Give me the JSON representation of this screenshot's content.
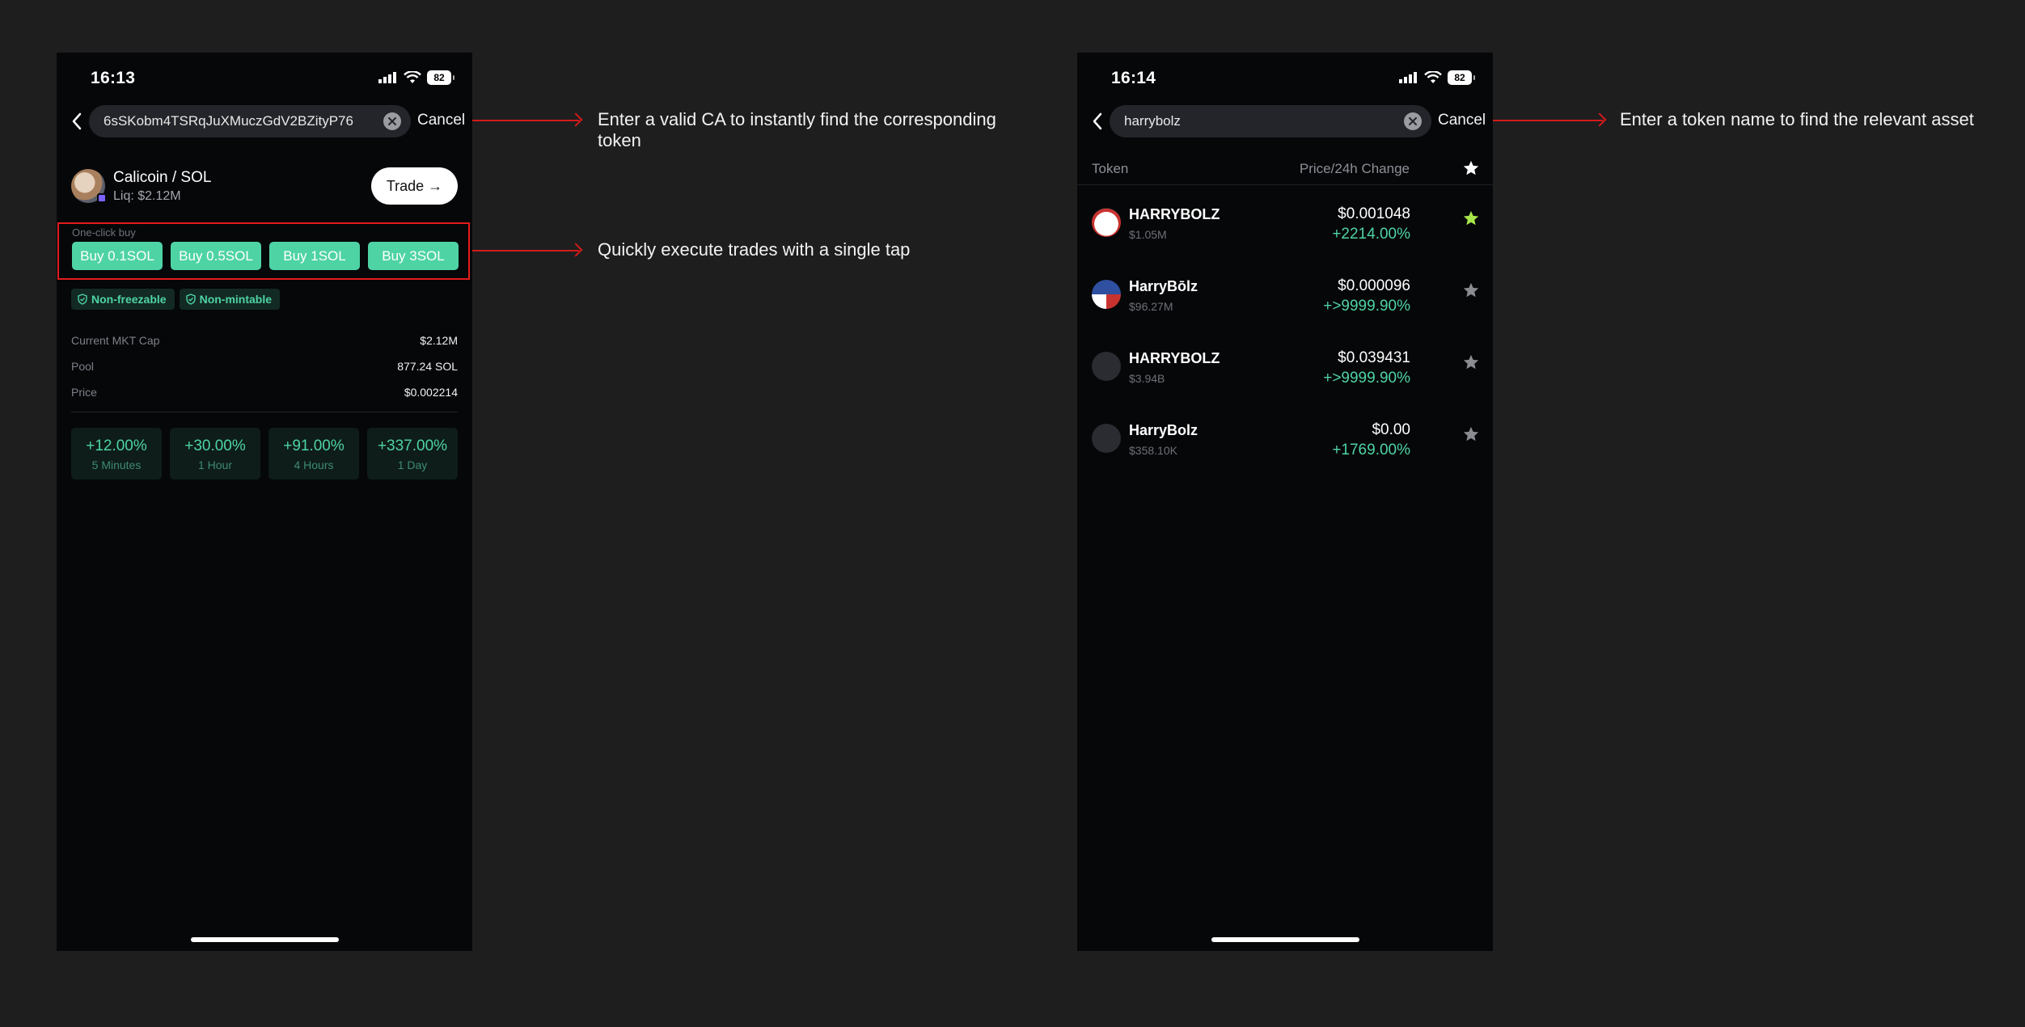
{
  "left_screen": {
    "status": {
      "time": "16:13",
      "battery": "82"
    },
    "search": {
      "value": "6sSKobm4TSRqJuXMuczGdV2BZityP76",
      "cancel_label": "Cancel"
    },
    "token": {
      "title": "Calicoin / SOL",
      "liquidity": "Liq: $2.12M",
      "trade_label": "Trade →"
    },
    "one_click": {
      "label": "One-click buy",
      "buttons": [
        "Buy 0.1SOL",
        "Buy 0.5SOL",
        "Buy 1SOL",
        "Buy 3SOL"
      ]
    },
    "tags": [
      "Non-freezable",
      "Non-mintable"
    ],
    "stats": [
      {
        "label": "Current MKT Cap",
        "value": "$2.12M"
      },
      {
        "label": "Pool",
        "value": "877.24 SOL"
      },
      {
        "label": "Price",
        "value": "$0.002214"
      }
    ],
    "changes": [
      {
        "value": "+12.00%",
        "period": "5 Minutes"
      },
      {
        "value": "+30.00%",
        "period": "1 Hour"
      },
      {
        "value": "+91.00%",
        "period": "4 Hours"
      },
      {
        "value": "+337.00%",
        "period": "1 Day"
      }
    ]
  },
  "right_screen": {
    "status": {
      "time": "16:14",
      "battery": "82"
    },
    "search": {
      "value": "harrybolz",
      "cancel_label": "Cancel"
    },
    "list_header": {
      "token": "Token",
      "price_change": "Price/24h Change"
    },
    "tokens": [
      {
        "name": "HARRYBOLZ",
        "mcap": "$1.05M",
        "price": "$0.001048",
        "change": "+2214.00%",
        "favorited": true
      },
      {
        "name": "HarryBōlz",
        "mcap": "$96.27M",
        "price": "$0.000096",
        "change": "+>9999.90%",
        "favorited": false
      },
      {
        "name": "HARRYBOLZ",
        "mcap": "$3.94B",
        "price": "$0.039431",
        "change": "+>9999.90%",
        "favorited": false
      },
      {
        "name": "HarryBolz",
        "mcap": "$358.10K",
        "price": "$0.00",
        "change": "+1769.00%",
        "favorited": false
      }
    ]
  },
  "annotations": {
    "search_ca": "Enter a valid CA to instantly find the corresponding token",
    "one_click": "Quickly execute trades with a single tap",
    "search_name": "Enter a token name to find the relevant asset"
  },
  "colors": {
    "background": "#1e1e1f",
    "phone_bg": "#060709",
    "accent_green": "#4ed3a4",
    "highlight_red": "#e21b1b",
    "favorite_star": "#a6e64a"
  }
}
